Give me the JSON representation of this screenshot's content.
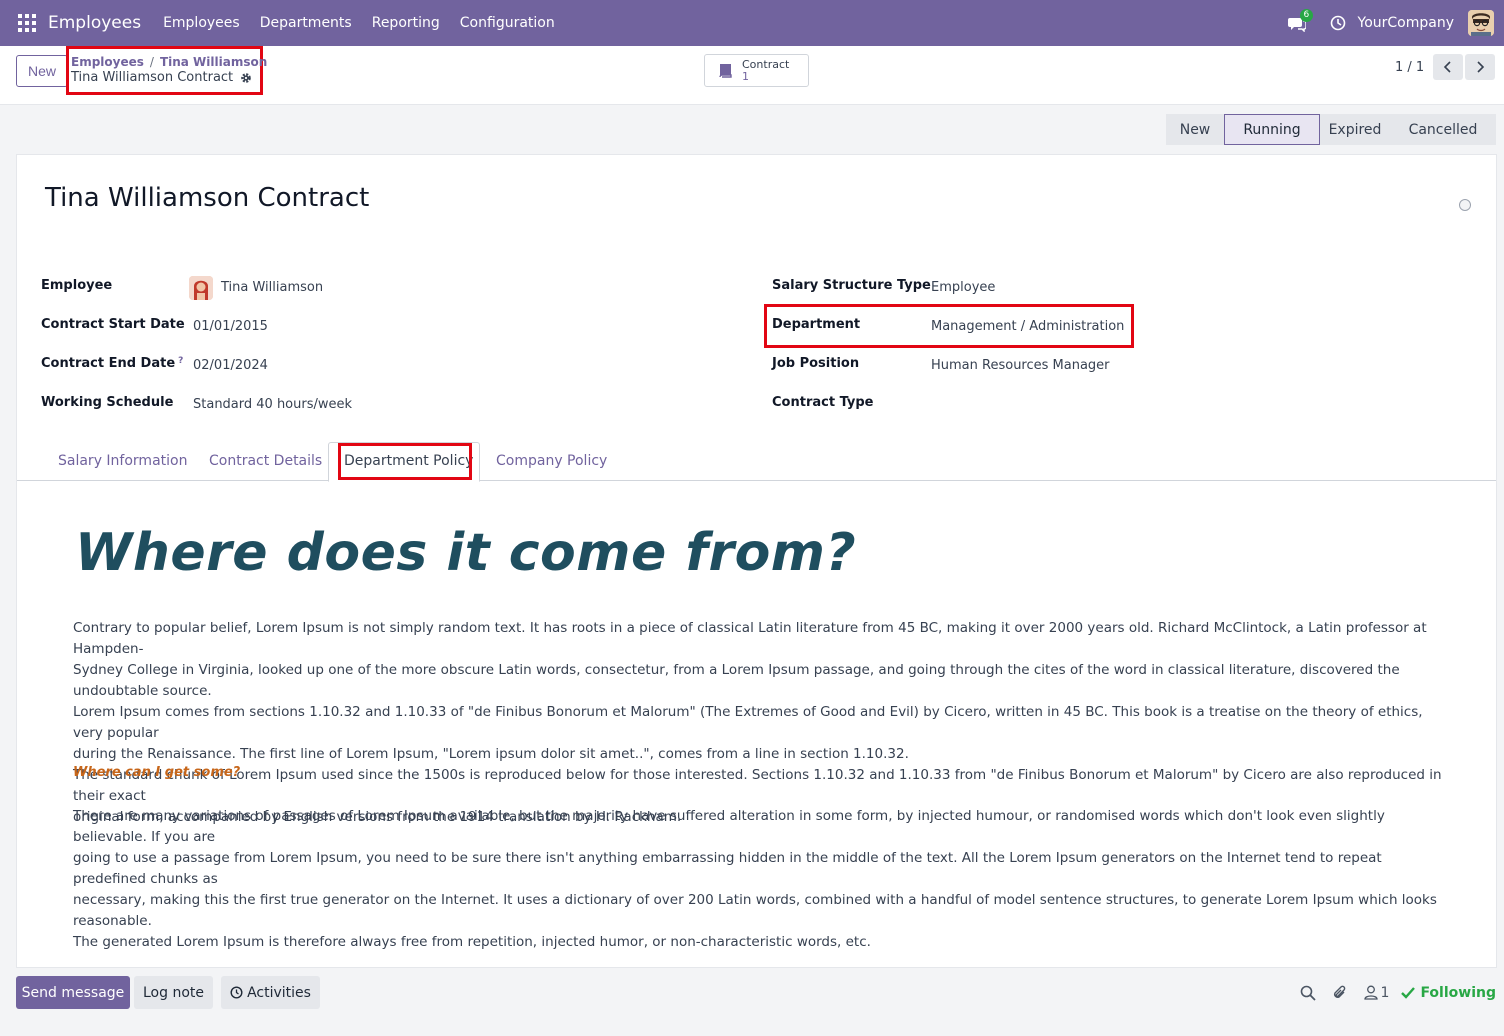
{
  "navbar": {
    "brand": "Employees",
    "menu": [
      "Employees",
      "Departments",
      "Reporting",
      "Configuration"
    ],
    "chat_count": "6",
    "company": "YourCompany"
  },
  "control": {
    "new_label": "New",
    "breadcrumb": [
      "Employees",
      "Tina Williamson"
    ],
    "current": "Tina Williamson Contract",
    "smart_button": {
      "label": "Contract",
      "count": "1"
    },
    "pager": "1 / 1"
  },
  "status_stages": [
    "New",
    "Running",
    "Expired",
    "Cancelled"
  ],
  "status_active": "Running",
  "record": {
    "title": "Tina Williamson Contract",
    "left_fields": [
      {
        "label": "Employee",
        "value": "Tina Williamson"
      },
      {
        "label": "Contract Start Date",
        "value": "01/01/2015"
      },
      {
        "label": "Contract End Date",
        "value": "02/01/2024",
        "help": "?"
      },
      {
        "label": "Working Schedule",
        "value": "Standard 40 hours/week"
      }
    ],
    "right_fields": [
      {
        "label": "Salary Structure Type",
        "value": "Employee"
      },
      {
        "label": "Department",
        "value": "Management / Administration"
      },
      {
        "label": "Job Position",
        "value": "Human Resources Manager"
      },
      {
        "label": "Contract Type",
        "value": ""
      }
    ]
  },
  "tabs": [
    "Salary Information",
    "Contract Details",
    "Department Policy",
    "Company Policy"
  ],
  "active_tab": "Department Policy",
  "content": {
    "heading": "Where does it come from?",
    "para1": [
      "Contrary to popular belief, Lorem Ipsum is not simply random text. It has roots in a piece of classical Latin literature from 45 BC, making it over 2000 years old. Richard McClintock, a Latin professor at Hampden-",
      "Sydney College in Virginia, looked up one of the more obscure Latin words, consectetur, from a Lorem Ipsum passage, and going through the cites of the word in classical literature, discovered the undoubtable source.",
      "Lorem Ipsum comes from sections 1.10.32 and 1.10.33 of \"de Finibus Bonorum et Malorum\" (The Extremes of Good and Evil) by Cicero, written in 45 BC. This book is a treatise on the theory of ethics, very popular",
      "during the Renaissance. The first line of Lorem Ipsum, \"Lorem ipsum dolor sit amet..\", comes from a line in section 1.10.32.",
      "The standard chunk of Lorem Ipsum used since the 1500s is reproduced below for those interested. Sections 1.10.32 and 1.10.33 from \"de Finibus Bonorum et Malorum\" by Cicero are also reproduced in their exact",
      "original form, accompanied by English versions from the 1914 translation by H. Rackham."
    ],
    "subheading": "Where can I get some?",
    "para2": [
      "There are many variations of passages of Lorem Ipsum available, but the majority have suffered alteration in some form, by injected humour, or randomised words which don't look even slightly believable. If you are",
      "going to use a passage from Lorem Ipsum, you need to be sure there isn't anything embarrassing hidden in the middle of the text. All the Lorem Ipsum generators on the Internet tend to repeat predefined chunks as",
      "necessary, making this the first true generator on the Internet. It uses a dictionary of over 200 Latin words, combined with a handful of model sentence structures, to generate Lorem Ipsum which looks reasonable.",
      "The generated Lorem Ipsum is therefore always free from repetition, injected humor, or non-characteristic words, etc."
    ]
  },
  "chatter": {
    "send": "Send message",
    "log": "Log note",
    "activities": "Activities",
    "followers": "1",
    "following": "Following"
  },
  "colors": {
    "primary": "#71639e",
    "highlight": "#e20613",
    "heading": "#1f4e5f",
    "subheading": "#c7661a",
    "following": "#28a745"
  }
}
